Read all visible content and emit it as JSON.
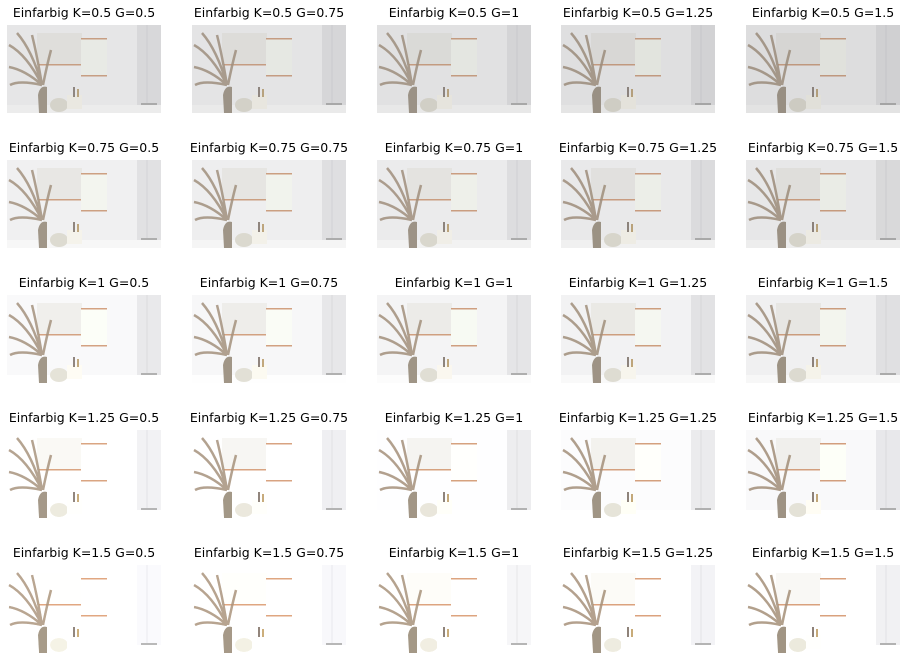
{
  "figure": {
    "rows": [
      [
        "Einfarbig K=0.5 G=0.5",
        "Einfarbig K=0.5 G=0.75",
        "Einfarbig K=0.5 G=1",
        "Einfarbig K=0.5 G=1.25",
        "Einfarbig K=0.5 G=1.5"
      ],
      [
        "Einfarbig K=0.75 G=0.5",
        "Einfarbig K=0.75 G=0.75",
        "Einfarbig K=0.75 G=1",
        "Einfarbig K=0.75 G=1.25",
        "Einfarbig K=0.75 G=1.5"
      ],
      [
        "Einfarbig K=1 G=0.5",
        "Einfarbig K=1 G=0.75",
        "Einfarbig K=1 G=1",
        "Einfarbig K=1 G=1.25",
        "Einfarbig K=1 G=1.5"
      ],
      [
        "Einfarbig K=1.25 G=0.5",
        "Einfarbig K=1.25 G=0.75",
        "Einfarbig K=1.25 G=1",
        "Einfarbig K=1.25 G=1.25",
        "Einfarbig K=1.25 G=1.5"
      ],
      [
        "Einfarbig K=1.5 G=0.5",
        "Einfarbig K=1.5 G=0.75",
        "Einfarbig K=1.5 G=1",
        "Einfarbig K=1.5 G=1.25",
        "Einfarbig K=1.5 G=1.5"
      ]
    ],
    "contrast_levels": [
      0.5,
      0.75,
      1,
      1.25,
      1.5
    ],
    "gamma_levels": [
      0.5,
      0.75,
      1,
      1.25,
      1.5
    ],
    "colors": {
      "background": "#ffffff",
      "wall": "#e6e6e6",
      "frame_bar": "#c89a7c",
      "pampas": "#9c8b78",
      "vase": "#9a9082"
    }
  }
}
